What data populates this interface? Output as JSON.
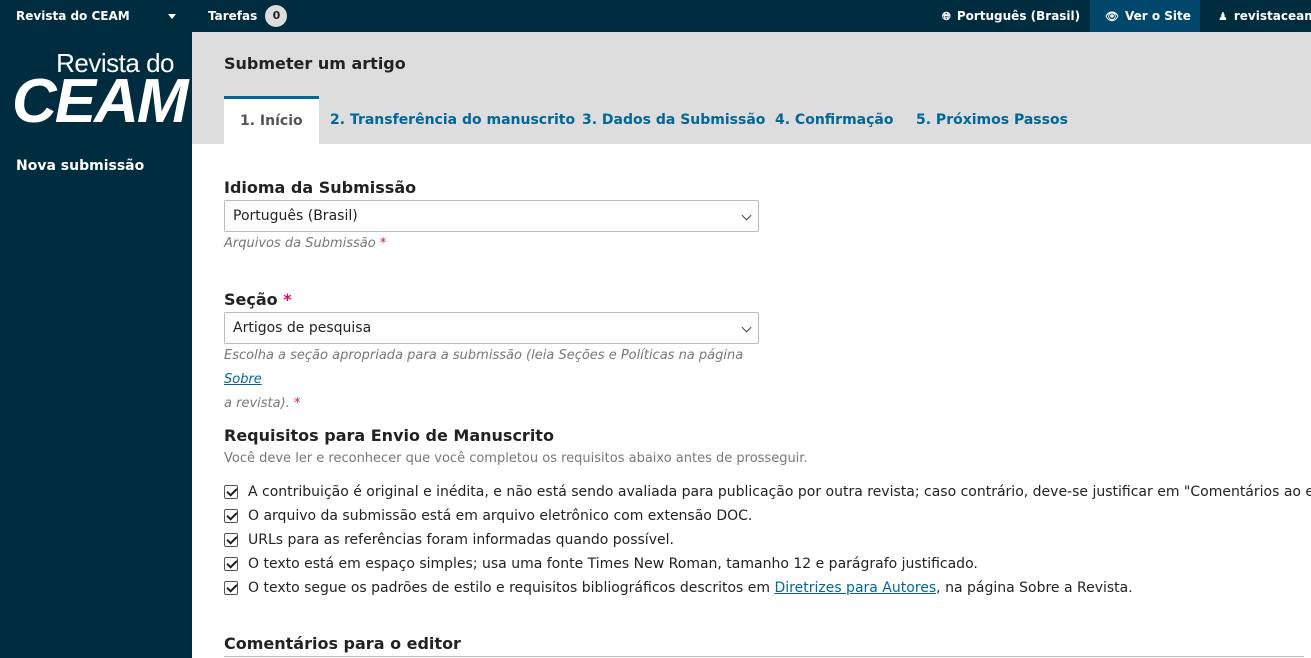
{
  "topbar": {
    "journal_name": "Revista do CEAM",
    "tasks_label": "Tarefas",
    "tasks_count": "0",
    "language": "Português (Brasil)",
    "view_site": "Ver o Site",
    "username": "revistaceam"
  },
  "sidebar": {
    "logo_line1": "Revista do",
    "logo_line2": "CEAM",
    "nav_item": "Nova submissão"
  },
  "header": {
    "title": "Submeter um artigo",
    "tabs": [
      {
        "label": "1. Início"
      },
      {
        "label": "2. Transferência do manuscrito"
      },
      {
        "label": "3. Dados da Submissão"
      },
      {
        "label": "4. Confirmação"
      },
      {
        "label": "5. Próximos Passos"
      }
    ]
  },
  "form": {
    "language_label": "Idioma da Submissão",
    "language_value": "Português (Brasil)",
    "language_hint": "Arquivos da Submissão",
    "section_label": "Seção",
    "section_value": "Artigos de pesquisa",
    "section_hint_line1": "Escolha a seção apropriada para a submissão (leia Seções e Políticas na página ",
    "section_hint_link": "Sobre",
    "section_hint_line2": "a revista).",
    "required_mark": "*",
    "requirements_label": "Requisitos para Envio de Manuscrito",
    "requirements_intro": "Você deve ler e reconhecer que você completou os requisitos abaixo antes de prosseguir.",
    "requirements": [
      {
        "text": "A contribuição é original e inédita, e não está sendo avaliada para publicação por outra revista; caso contrário, deve-se justificar em \"Comentários ao editor\".",
        "checked": true
      },
      {
        "text": "O arquivo da submissão está em arquivo eletrônico com extensão DOC.",
        "checked": true
      },
      {
        "text": "URLs para as referências foram informadas quando possível.",
        "checked": true
      },
      {
        "text": "O texto está em espaço simples; usa uma fonte Times New Roman, tamanho 12 e parágrafo justificado.",
        "checked": true
      },
      {
        "text_before": "O texto segue os padrões de estilo e requisitos bibliográficos descritos em ",
        "link": "Diretrizes para Autores",
        "text_after": ", na página Sobre a Revista.",
        "checked": true
      }
    ],
    "comments_label": "Comentários para o editor"
  },
  "colors": {
    "topbar_bg": "#002c40",
    "accent": "#006798",
    "required": "#d00a6c",
    "header_bg": "#dddddd"
  }
}
